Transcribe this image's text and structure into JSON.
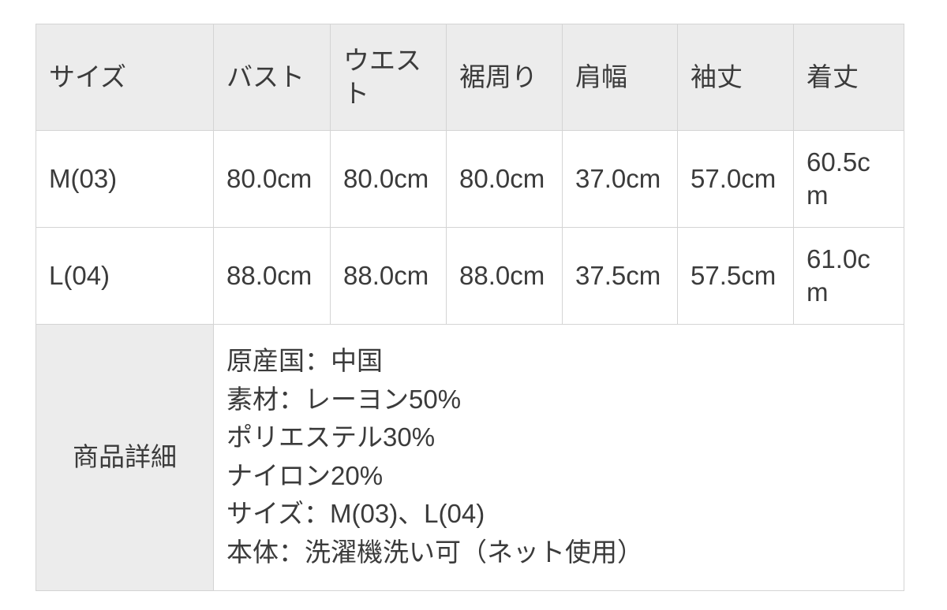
{
  "table": {
    "headers": [
      "サイズ",
      "バスト",
      "ウエスト",
      "裾周り",
      "肩幅",
      "袖丈",
      "着丈"
    ],
    "rows": [
      {
        "size": "M(03)",
        "bust": "80.0cm",
        "waist": "80.0cm",
        "hem": "80.0cm",
        "shoulder": "37.0cm",
        "sleeve": "57.0cm",
        "length": "60.5cm"
      },
      {
        "size": "L(04)",
        "bust": "88.0cm",
        "waist": "88.0cm",
        "hem": "88.0cm",
        "shoulder": "37.5cm",
        "sleeve": "57.5cm",
        "length": "61.0cm"
      }
    ],
    "detail": {
      "label": "商品詳細",
      "lines": [
        "原産国：中国",
        "素材：レーヨン50%",
        "ポリエステル30%",
        "ナイロン20%",
        "サイズ：M(03)、L(04)",
        "本体：洗濯機洗い可（ネット使用）"
      ]
    }
  },
  "colors": {
    "header_background": "#ececec",
    "cell_background": "#ffffff",
    "border": "#d4d4d4",
    "text": "#3b3b3b"
  }
}
